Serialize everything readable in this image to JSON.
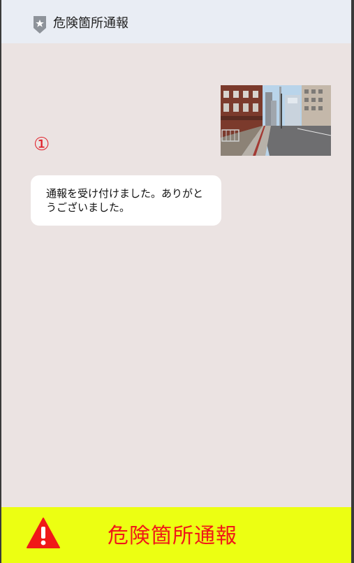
{
  "header": {
    "title": "危険箇所通報",
    "icon": "map-pin-star-icon"
  },
  "chat": {
    "photo": {
      "icon": "street-photo-thumbnail"
    },
    "number_marker": "①",
    "reply_text": "通報を受け付けました。ありがとうございました。"
  },
  "footer": {
    "button_label": "危険箇所通報",
    "icon": "warning-triangle-icon",
    "background_color": "#ecff12",
    "text_color": "#f01818"
  }
}
